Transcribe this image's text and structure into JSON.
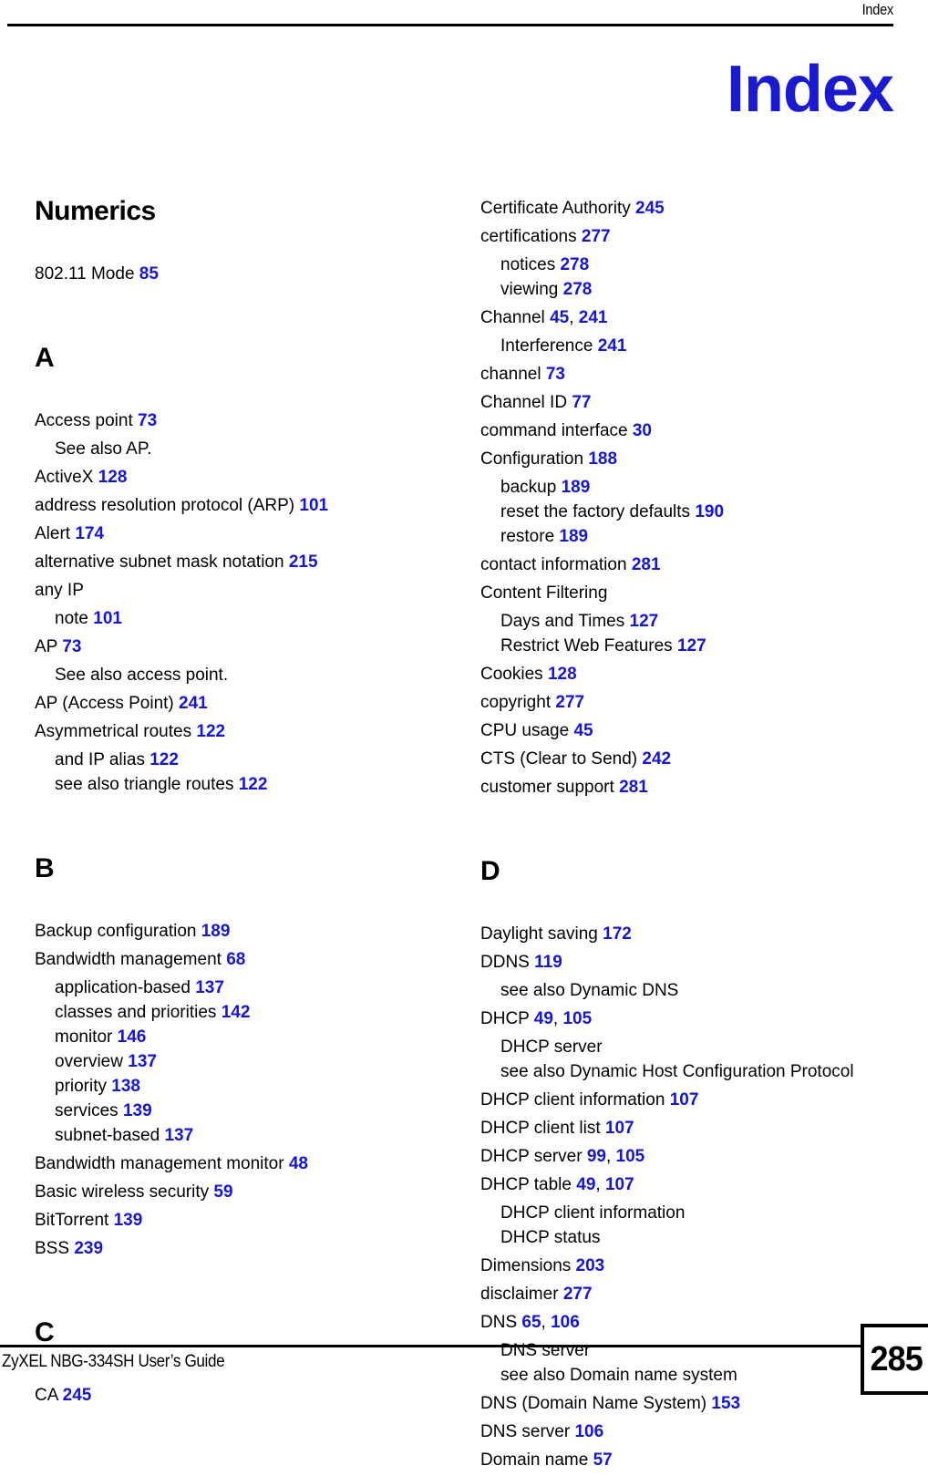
{
  "header": {
    "running_head": "Index"
  },
  "title": "Index",
  "columns": [
    {
      "name": "left",
      "groups": [
        {
          "letter": "Numerics",
          "entries": [
            {
              "term": "802.11 Mode",
              "pages": "85",
              "level": 0
            }
          ]
        },
        {
          "letter": "A",
          "entries": [
            {
              "term": "Access point",
              "pages": "73",
              "level": 0
            },
            {
              "term": "See also AP.",
              "pages": "",
              "level": 1
            },
            {
              "term": "ActiveX",
              "pages": "128",
              "level": 0
            },
            {
              "term": "address resolution protocol (ARP)",
              "pages": "101",
              "level": 0
            },
            {
              "term": "Alert",
              "pages": "174",
              "level": 0
            },
            {
              "term": "alternative subnet mask notation",
              "pages": "215",
              "level": 0
            },
            {
              "term": "any IP",
              "pages": "",
              "level": 0
            },
            {
              "term": "note",
              "pages": "101",
              "level": 1
            },
            {
              "term": "AP",
              "pages": "73",
              "level": 0
            },
            {
              "term": "See also access point.",
              "pages": "",
              "level": 1
            },
            {
              "term": "AP (Access Point)",
              "pages": "241",
              "level": 0
            },
            {
              "term": "Asymmetrical routes",
              "pages": "122",
              "level": 0
            },
            {
              "term": "and IP alias",
              "pages": "122",
              "level": 1
            },
            {
              "term": "see also triangle routes",
              "pages": "122",
              "level": 1
            }
          ]
        },
        {
          "letter": "B",
          "entries": [
            {
              "term": "Backup configuration",
              "pages": "189",
              "level": 0
            },
            {
              "term": "Bandwidth management",
              "pages": "68",
              "level": 0
            },
            {
              "term": "application-based",
              "pages": "137",
              "level": 1
            },
            {
              "term": "classes and priorities",
              "pages": "142",
              "level": 1
            },
            {
              "term": "monitor",
              "pages": "146",
              "level": 1
            },
            {
              "term": "overview",
              "pages": "137",
              "level": 1
            },
            {
              "term": "priority",
              "pages": "138",
              "level": 1
            },
            {
              "term": "services",
              "pages": "139",
              "level": 1
            },
            {
              "term": "subnet-based",
              "pages": "137",
              "level": 1
            },
            {
              "term": "Bandwidth management monitor",
              "pages": "48",
              "level": 0
            },
            {
              "term": "Basic wireless security",
              "pages": "59",
              "level": 0
            },
            {
              "term": "BitTorrent",
              "pages": "139",
              "level": 0
            },
            {
              "term": "BSS",
              "pages": "239",
              "level": 0
            }
          ]
        },
        {
          "letter": "C",
          "entries": [
            {
              "term": "CA",
              "pages": "245",
              "level": 0
            }
          ]
        }
      ]
    },
    {
      "name": "right",
      "groups": [
        {
          "letter": "",
          "entries": [
            {
              "term": "Certificate Authority",
              "pages": "245",
              "level": 0
            },
            {
              "term": "certifications",
              "pages": "277",
              "level": 0
            },
            {
              "term": "notices",
              "pages": "278",
              "level": 1
            },
            {
              "term": "viewing",
              "pages": "278",
              "level": 1
            },
            {
              "term": "Channel",
              "pages": "45, 241",
              "level": 0
            },
            {
              "term": "Interference",
              "pages": "241",
              "level": 1
            },
            {
              "term": "channel",
              "pages": "73",
              "level": 0
            },
            {
              "term": "Channel ID",
              "pages": "77",
              "level": 0
            },
            {
              "term": "command interface",
              "pages": "30",
              "level": 0
            },
            {
              "term": "Configuration",
              "pages": "188",
              "level": 0
            },
            {
              "term": "backup",
              "pages": "189",
              "level": 1
            },
            {
              "term": "reset the factory defaults",
              "pages": "190",
              "level": 1
            },
            {
              "term": "restore",
              "pages": "189",
              "level": 1
            },
            {
              "term": "contact information",
              "pages": "281",
              "level": 0
            },
            {
              "term": "Content Filtering",
              "pages": "",
              "level": 0
            },
            {
              "term": "Days and Times",
              "pages": "127",
              "level": 1
            },
            {
              "term": "Restrict Web Features",
              "pages": "127",
              "level": 1
            },
            {
              "term": "Cookies",
              "pages": "128",
              "level": 0
            },
            {
              "term": "copyright",
              "pages": "277",
              "level": 0
            },
            {
              "term": "CPU usage",
              "pages": "45",
              "level": 0
            },
            {
              "term": "CTS (Clear to Send)",
              "pages": "242",
              "level": 0
            },
            {
              "term": "customer support",
              "pages": "281",
              "level": 0
            }
          ]
        },
        {
          "letter": "D",
          "entries": [
            {
              "term": "Daylight saving",
              "pages": "172",
              "level": 0
            },
            {
              "term": "DDNS",
              "pages": "119",
              "level": 0
            },
            {
              "term": "see also Dynamic DNS",
              "pages": "",
              "level": 1
            },
            {
              "term": "DHCP",
              "pages": "49, 105",
              "level": 0
            },
            {
              "term": "DHCP server",
              "pages": "",
              "level": 1
            },
            {
              "term": "see also Dynamic Host Configuration Protocol",
              "pages": "",
              "level": 1
            },
            {
              "term": "DHCP client information",
              "pages": "107",
              "level": 0
            },
            {
              "term": "DHCP client list",
              "pages": "107",
              "level": 0
            },
            {
              "term": "DHCP server",
              "pages": "99, 105",
              "level": 0
            },
            {
              "term": "DHCP table",
              "pages": "49, 107",
              "level": 0
            },
            {
              "term": "DHCP client information",
              "pages": "",
              "level": 1
            },
            {
              "term": "DHCP status",
              "pages": "",
              "level": 1
            },
            {
              "term": "Dimensions",
              "pages": "203",
              "level": 0
            },
            {
              "term": "disclaimer",
              "pages": "277",
              "level": 0
            },
            {
              "term": "DNS",
              "pages": "65, 106",
              "level": 0
            },
            {
              "term": "DNS server",
              "pages": "",
              "level": 1
            },
            {
              "term": "see also Domain name system",
              "pages": "",
              "level": 1
            },
            {
              "term": "DNS (Domain Name System)",
              "pages": "153",
              "level": 0
            },
            {
              "term": "DNS server",
              "pages": "106",
              "level": 0
            },
            {
              "term": "Domain name",
              "pages": "57",
              "level": 0
            }
          ]
        }
      ]
    }
  ],
  "footer": {
    "guide_title": "ZyXEL NBG-334SH User’s Guide",
    "page_number": "285"
  },
  "colors": {
    "page_link_blue": "#1414e6",
    "title_blue": "#1a19d4",
    "text_black": "#000000"
  }
}
